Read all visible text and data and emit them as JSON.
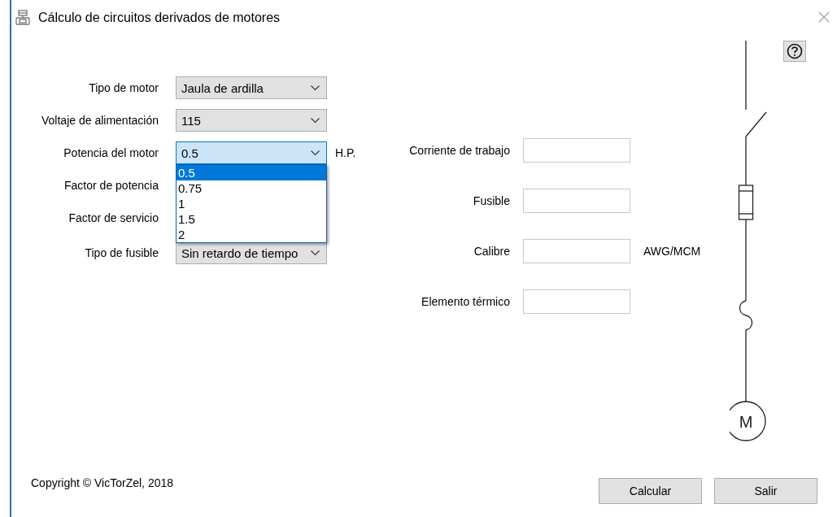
{
  "window": {
    "title": "Cálculo de circuitos derivados de motores"
  },
  "inputs": [
    {
      "label": "Tipo de motor",
      "value": "Jaula de ardilla",
      "focused": false
    },
    {
      "label": "Voltaje de alimentación",
      "value": "115",
      "focused": false
    },
    {
      "label": "Potencia del motor",
      "value": "0.5",
      "focused": true,
      "unit": "H.P.",
      "expanded": true,
      "options": [
        {
          "label": "0.5",
          "selected": true
        },
        {
          "label": "0.75",
          "selected": false
        },
        {
          "label": "1",
          "selected": false
        },
        {
          "label": "1.5",
          "selected": false
        },
        {
          "label": "2",
          "selected": false
        }
      ]
    },
    {
      "label": "Factor de potencia"
    },
    {
      "label": "Factor de servicio"
    },
    {
      "label": "Tipo de fusible",
      "value": "Sin retardo de tiempo",
      "focused": false
    }
  ],
  "results": [
    {
      "label": "Corriente de trabajo"
    },
    {
      "label": "Fusible"
    },
    {
      "label": "Calibre",
      "unit": "AWG/MCM"
    },
    {
      "label": "Elemento térmico"
    }
  ],
  "diagram": {
    "motor_label": "M"
  },
  "copyright": "Copyright © VicTorZel, 2018",
  "buttons": [
    "Calcular",
    "Salir"
  ]
}
